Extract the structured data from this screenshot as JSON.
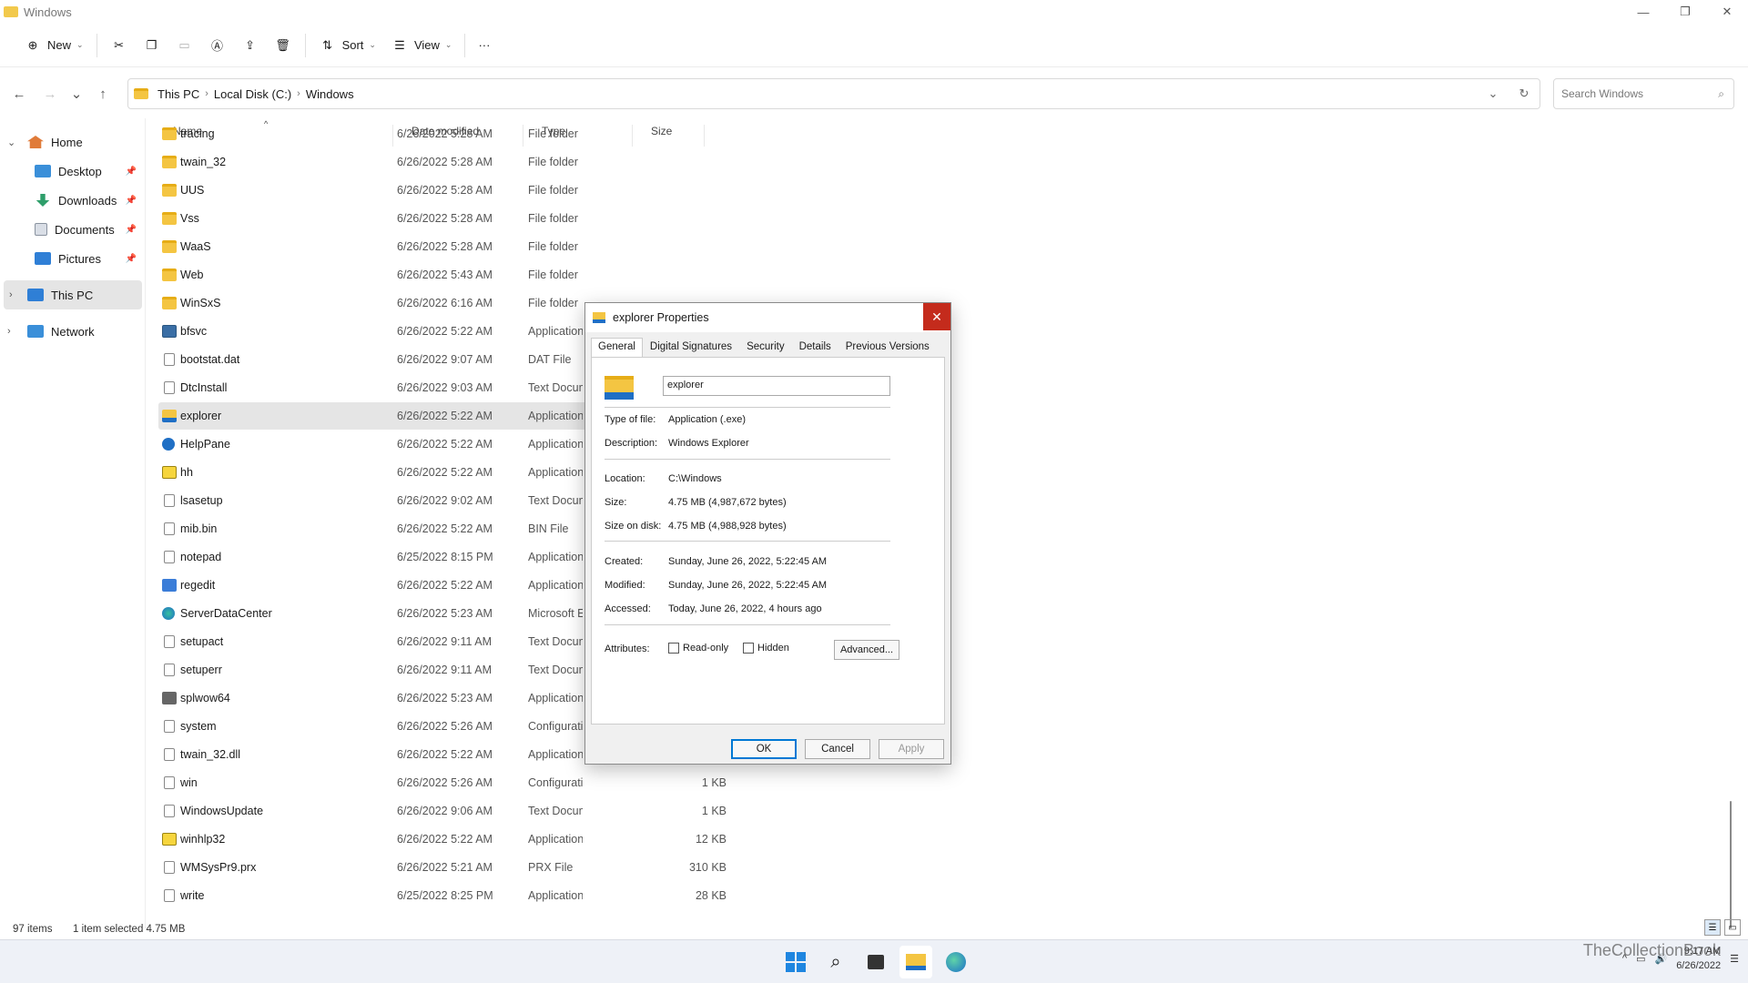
{
  "window": {
    "title": "Windows",
    "minimize": "—",
    "maximize": "❐",
    "close": "✕"
  },
  "toolbar": {
    "new_label": "New",
    "sort_label": "Sort",
    "view_label": "View",
    "more": "···"
  },
  "address": {
    "crumbs": [
      "This PC",
      "Local Disk (C:)",
      "Windows"
    ]
  },
  "search": {
    "placeholder": "Search Windows"
  },
  "sidebar": {
    "home": "Home",
    "quick": [
      {
        "label": "Desktop",
        "icon": "desktop-icon"
      },
      {
        "label": "Downloads",
        "icon": "download-icon"
      },
      {
        "label": "Documents",
        "icon": "documents-icon"
      },
      {
        "label": "Pictures",
        "icon": "pictures-icon"
      }
    ],
    "this_pc": "This PC",
    "network": "Network"
  },
  "columns": {
    "name": "Name",
    "date": "Date modified",
    "type": "Type",
    "size": "Size"
  },
  "files": [
    {
      "name": "tracing",
      "date": "6/26/2022 5:28 AM",
      "type": "File folder",
      "size": "",
      "icon": "folder"
    },
    {
      "name": "twain_32",
      "date": "6/26/2022 5:28 AM",
      "type": "File folder",
      "size": "",
      "icon": "folder"
    },
    {
      "name": "UUS",
      "date": "6/26/2022 5:28 AM",
      "type": "File folder",
      "size": "",
      "icon": "folder"
    },
    {
      "name": "Vss",
      "date": "6/26/2022 5:28 AM",
      "type": "File folder",
      "size": "",
      "icon": "folder"
    },
    {
      "name": "WaaS",
      "date": "6/26/2022 5:28 AM",
      "type": "File folder",
      "size": "",
      "icon": "folder"
    },
    {
      "name": "Web",
      "date": "6/26/2022 5:43 AM",
      "type": "File folder",
      "size": "",
      "icon": "folder"
    },
    {
      "name": "WinSxS",
      "date": "6/26/2022 6:16 AM",
      "type": "File folder",
      "size": "",
      "icon": "folder"
    },
    {
      "name": "bfsvc",
      "date": "6/26/2022 5:22 AM",
      "type": "Application",
      "size": "",
      "icon": "app"
    },
    {
      "name": "bootstat.dat",
      "date": "6/26/2022 9:07 AM",
      "type": "DAT File",
      "size": "",
      "icon": "file"
    },
    {
      "name": "DtcInstall",
      "date": "6/26/2022 9:03 AM",
      "type": "Text Document",
      "size": "",
      "icon": "file"
    },
    {
      "name": "explorer",
      "date": "6/26/2022 5:22 AM",
      "type": "Application",
      "size": "",
      "icon": "expl"
    },
    {
      "name": "HelpPane",
      "date": "6/26/2022 5:22 AM",
      "type": "Application",
      "size": "",
      "icon": "help"
    },
    {
      "name": "hh",
      "date": "6/26/2022 5:22 AM",
      "type": "Application",
      "size": "",
      "icon": "q"
    },
    {
      "name": "lsasetup",
      "date": "6/26/2022 9:02 AM",
      "type": "Text Document",
      "size": "",
      "icon": "file"
    },
    {
      "name": "mib.bin",
      "date": "6/26/2022 5:22 AM",
      "type": "BIN File",
      "size": "",
      "icon": "file"
    },
    {
      "name": "notepad",
      "date": "6/25/2022 8:15 PM",
      "type": "Application",
      "size": "",
      "icon": "file"
    },
    {
      "name": "regedit",
      "date": "6/26/2022 5:22 AM",
      "type": "Application",
      "size": "",
      "icon": "reg"
    },
    {
      "name": "ServerDataCenter",
      "date": "6/26/2022 5:23 AM",
      "type": "Microsoft Edge",
      "size": "",
      "icon": "edge"
    },
    {
      "name": "setupact",
      "date": "6/26/2022 9:11 AM",
      "type": "Text Document",
      "size": "",
      "icon": "file"
    },
    {
      "name": "setuperr",
      "date": "6/26/2022 9:11 AM",
      "type": "Text Document",
      "size": "",
      "icon": "file"
    },
    {
      "name": "splwow64",
      "date": "6/26/2022 5:23 AM",
      "type": "Application",
      "size": "",
      "icon": "prn"
    },
    {
      "name": "system",
      "date": "6/26/2022 5:26 AM",
      "type": "Configuration settings",
      "size": "",
      "icon": "file"
    },
    {
      "name": "twain_32.dll",
      "date": "6/26/2022 5:22 AM",
      "type": "Application exten...",
      "size": "66 KB",
      "icon": "file"
    },
    {
      "name": "win",
      "date": "6/26/2022 5:26 AM",
      "type": "Configuration sett...",
      "size": "1 KB",
      "icon": "file"
    },
    {
      "name": "WindowsUpdate",
      "date": "6/26/2022 9:06 AM",
      "type": "Text Document",
      "size": "1 KB",
      "icon": "file"
    },
    {
      "name": "winhlp32",
      "date": "6/26/2022 5:22 AM",
      "type": "Application",
      "size": "12 KB",
      "icon": "q"
    },
    {
      "name": "WMSysPr9.prx",
      "date": "6/26/2022 5:21 AM",
      "type": "PRX File",
      "size": "310 KB",
      "icon": "file"
    },
    {
      "name": "write",
      "date": "6/25/2022 8:25 PM",
      "type": "Application",
      "size": "28 KB",
      "icon": "file"
    }
  ],
  "status": {
    "count": "97 items",
    "selected": "1 item selected  4.75 MB"
  },
  "dialog": {
    "title": "explorer Properties",
    "tabs": [
      "General",
      "Digital Signatures",
      "Security",
      "Details",
      "Previous Versions"
    ],
    "name_value": "explorer",
    "fields": [
      {
        "label": "Type of file:",
        "value": "Application (.exe)"
      },
      {
        "label": "Description:",
        "value": "Windows Explorer"
      },
      {
        "label": "Location:",
        "value": "C:\\Windows"
      },
      {
        "label": "Size:",
        "value": "4.75 MB (4,987,672 bytes)"
      },
      {
        "label": "Size on disk:",
        "value": "4.75 MB (4,988,928 bytes)"
      },
      {
        "label": "Created:",
        "value": "Sunday, June 26, 2022, 5:22:45 AM"
      },
      {
        "label": "Modified:",
        "value": "Sunday, June 26, 2022, 5:22:45 AM"
      },
      {
        "label": "Accessed:",
        "value": "Today, June 26, 2022, 4 hours ago"
      }
    ],
    "attributes_label": "Attributes:",
    "readonly_label": "Read-only",
    "hidden_label": "Hidden",
    "advanced_label": "Advanced...",
    "ok_label": "OK",
    "cancel_label": "Cancel",
    "apply_label": "Apply"
  },
  "taskbar": {
    "time": "9:17 AM",
    "date": "6/26/2022",
    "watermark": "TheCollectionBook"
  },
  "colors": {
    "accent": "#0078d4",
    "close_red": "#c42b1c",
    "folder": "#f4c542"
  }
}
